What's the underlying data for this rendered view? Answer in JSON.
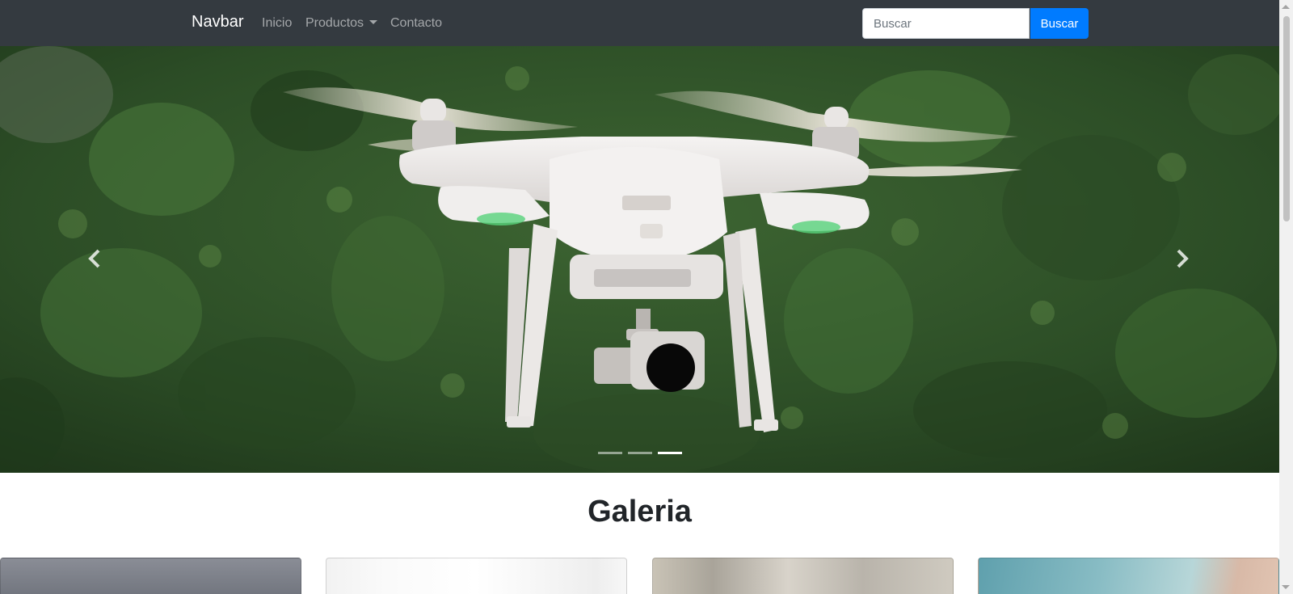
{
  "navbar": {
    "brand": "Navbar",
    "links": [
      {
        "label": "Inicio"
      },
      {
        "label": "Productos"
      },
      {
        "label": "Contacto"
      }
    ],
    "search_placeholder": "Buscar",
    "search_button": "Buscar",
    "background_color": "#343a40",
    "button_color": "#007bff"
  },
  "carousel": {
    "slide_count": 3,
    "active_slide": 3,
    "prev_icon": "chevron-left-icon",
    "next_icon": "chevron-right-icon",
    "image_subject": "drone"
  },
  "gallery": {
    "title": "Galeria",
    "card_count": 4
  }
}
